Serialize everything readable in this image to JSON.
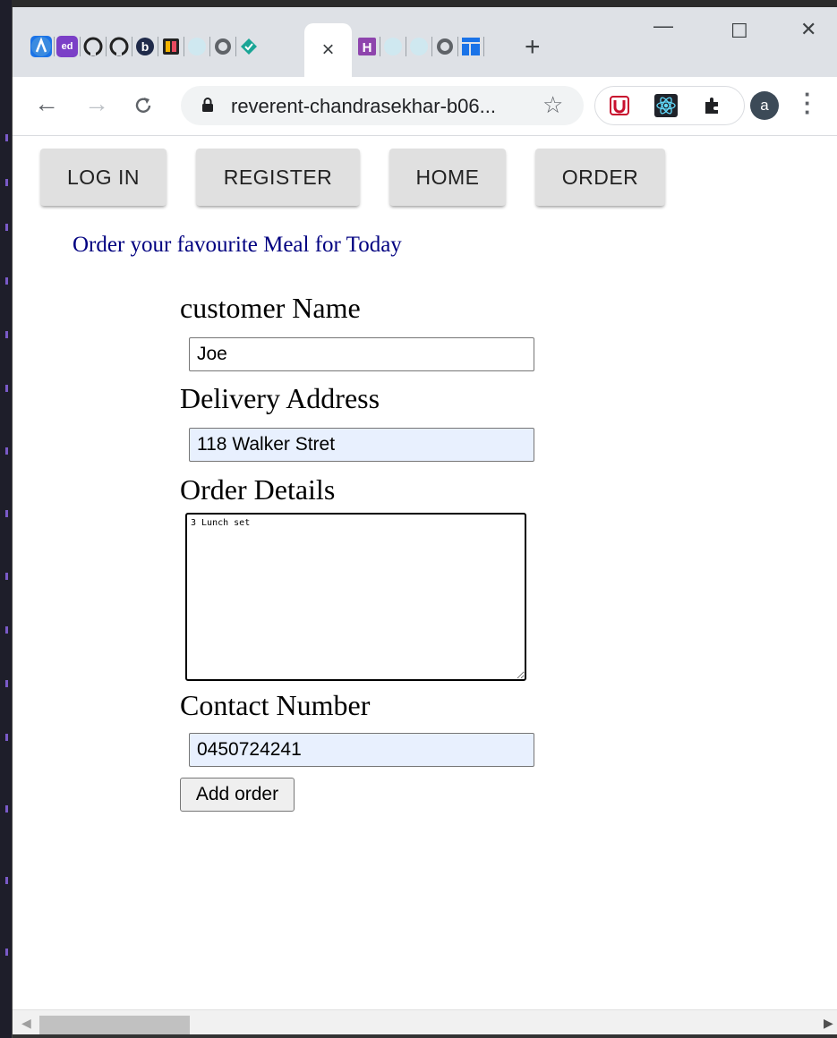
{
  "browser": {
    "active_tab_close": "×",
    "new_tab": "+",
    "window_controls": {
      "minimize": "—",
      "maximize": "☐",
      "close": "✕"
    },
    "url": "reverent-chandrasekhar-b06...",
    "profile_initial": "a",
    "favicons_left": [
      "A",
      "ed",
      "github-icon",
      "github-icon",
      "b-icon",
      "app-icon",
      "globe-icon",
      "globe-icon",
      "diamond-icon"
    ],
    "favicons_right": [
      "H",
      "globe-icon",
      "globe-icon",
      "globe-icon",
      "grid-icon"
    ]
  },
  "nav": {
    "login": "LOG IN",
    "register": "REGISTER",
    "home": "HOME",
    "order": "ORDER"
  },
  "page": {
    "headline": "Order your favourite Meal for Today"
  },
  "form": {
    "customer_name_label": "customer Name",
    "customer_name_value": "Joe",
    "address_label": "Delivery Address",
    "address_value": "118 Walker Stret",
    "details_label": "Order Details",
    "details_value": "3 Lunch set",
    "contact_label": "Contact Number",
    "contact_value": "0450724241",
    "submit_label": "Add order"
  },
  "colors": {
    "headline": "#000080",
    "autofill_bg": "#e8f0fe",
    "nav_button_bg": "#e0e0e0",
    "tabstrip_bg": "#dee1e6"
  }
}
